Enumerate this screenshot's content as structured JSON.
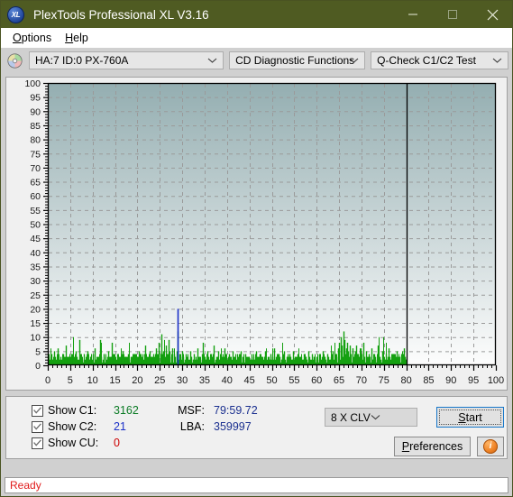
{
  "window": {
    "title": "PlexTools Professional XL V3.16",
    "app_icon_text": "XL",
    "minimize_label": "—",
    "maximize_label": "□",
    "close_label": "✕",
    "titlebar_color": "#4f5b22"
  },
  "menu": {
    "items": [
      {
        "label": "Options",
        "accel": "O"
      },
      {
        "label": "Help",
        "accel": "H"
      }
    ]
  },
  "toolbar": {
    "drive_select": {
      "value": "HA:7 ID:0  PX-760A"
    },
    "function_select": {
      "value": "CD Diagnostic Functions"
    },
    "test_select": {
      "value": "Q-Check C1/C2 Test"
    }
  },
  "controls": {
    "checkboxes": [
      {
        "label": "Show C1:",
        "value": "3162",
        "color": "#0a7a24",
        "checked": true
      },
      {
        "label": "Show C2:",
        "value": "21",
        "color": "#1a2fc8",
        "checked": true
      },
      {
        "label": "Show CU:",
        "value": "0",
        "color": "#cc0000",
        "checked": true
      }
    ],
    "readouts": [
      {
        "key": "MSF:",
        "value": "79:59.72"
      },
      {
        "key": "LBA:",
        "value": "359997"
      }
    ],
    "speed_select": {
      "value": "8 X CLV"
    },
    "start_button": {
      "label": "Start",
      "accel": "S"
    },
    "preferences_button": {
      "label": "Preferences",
      "accel": "P"
    },
    "info_button": {
      "label": "i"
    }
  },
  "status": {
    "text": "Ready",
    "color": "#e01b1b"
  },
  "chart_data": {
    "type": "bar",
    "title": "",
    "xlabel": "",
    "ylabel": "",
    "xlim": [
      0,
      100
    ],
    "ylim": [
      0,
      100
    ],
    "xticks": [
      0,
      5,
      10,
      15,
      20,
      25,
      30,
      35,
      40,
      45,
      50,
      55,
      60,
      65,
      70,
      75,
      80,
      85,
      90,
      95,
      100
    ],
    "yticks": [
      0,
      5,
      10,
      15,
      20,
      25,
      30,
      35,
      40,
      45,
      50,
      55,
      60,
      65,
      70,
      75,
      80,
      85,
      90,
      95,
      100
    ],
    "grid": true,
    "legend_position": "none",
    "data_end_marker_x": 80,
    "plot_bg_gradient": [
      "#94aeb1",
      "#fdfdfd"
    ],
    "series": [
      {
        "name": "C1",
        "color": "#14a010",
        "total": 3162,
        "baseline": 1,
        "points": [
          [
            0.2,
            3
          ],
          [
            0.5,
            2
          ],
          [
            0.8,
            4
          ],
          [
            1.1,
            2
          ],
          [
            1.4,
            5
          ],
          [
            1.7,
            2
          ],
          [
            2.0,
            3
          ],
          [
            2.3,
            6
          ],
          [
            2.6,
            2
          ],
          [
            2.9,
            3
          ],
          [
            3.2,
            2
          ],
          [
            3.5,
            4
          ],
          [
            3.8,
            3
          ],
          [
            4.1,
            7
          ],
          [
            4.4,
            2
          ],
          [
            4.7,
            3
          ],
          [
            5.0,
            2
          ],
          [
            5.3,
            4
          ],
          [
            5.6,
            3
          ],
          [
            5.9,
            2
          ],
          [
            6.2,
            5
          ],
          [
            6.5,
            3
          ],
          [
            6.8,
            2
          ],
          [
            7.1,
            9
          ],
          [
            7.4,
            3
          ],
          [
            7.7,
            2
          ],
          [
            8.0,
            4
          ],
          [
            8.3,
            2
          ],
          [
            8.6,
            3
          ],
          [
            8.9,
            5
          ],
          [
            9.2,
            2
          ],
          [
            9.5,
            3
          ],
          [
            9.8,
            2
          ],
          [
            10.1,
            4
          ],
          [
            10.4,
            6
          ],
          [
            10.7,
            2
          ],
          [
            11.0,
            3
          ],
          [
            11.3,
            2
          ],
          [
            11.6,
            9
          ],
          [
            11.9,
            3
          ],
          [
            12.2,
            2
          ],
          [
            12.5,
            4
          ],
          [
            12.8,
            3
          ],
          [
            13.1,
            2
          ],
          [
            13.4,
            5
          ],
          [
            13.7,
            2
          ],
          [
            14.0,
            3
          ],
          [
            14.3,
            8
          ],
          [
            14.6,
            2
          ],
          [
            14.9,
            3
          ],
          [
            15.2,
            2
          ],
          [
            15.5,
            4
          ],
          [
            15.8,
            3
          ],
          [
            16.1,
            2
          ],
          [
            16.4,
            3
          ],
          [
            16.7,
            5
          ],
          [
            17.0,
            2
          ],
          [
            17.3,
            3
          ],
          [
            17.6,
            2
          ],
          [
            17.9,
            4
          ],
          [
            18.2,
            3
          ],
          [
            18.5,
            2
          ],
          [
            18.8,
            3
          ],
          [
            19.1,
            2
          ],
          [
            19.4,
            4
          ],
          [
            19.7,
            2
          ],
          [
            20.0,
            3
          ],
          [
            20.3,
            5
          ],
          [
            20.6,
            2
          ],
          [
            20.9,
            3
          ],
          [
            21.2,
            2
          ],
          [
            21.5,
            4
          ],
          [
            21.8,
            7
          ],
          [
            22.1,
            3
          ],
          [
            22.4,
            2
          ],
          [
            22.7,
            5
          ],
          [
            23.0,
            3
          ],
          [
            23.3,
            2
          ],
          [
            23.6,
            4
          ],
          [
            23.9,
            3
          ],
          [
            24.2,
            6
          ],
          [
            24.5,
            3
          ],
          [
            24.8,
            8
          ],
          [
            25.1,
            4
          ],
          [
            25.4,
            11
          ],
          [
            25.7,
            5
          ],
          [
            26.0,
            3
          ],
          [
            26.3,
            7
          ],
          [
            26.6,
            4
          ],
          [
            26.9,
            9
          ],
          [
            27.2,
            5
          ],
          [
            27.5,
            3
          ],
          [
            27.8,
            6
          ],
          [
            28.1,
            4
          ],
          [
            28.4,
            3
          ],
          [
            28.7,
            5
          ],
          [
            29.0,
            12
          ],
          [
            29.3,
            4
          ],
          [
            29.6,
            3
          ],
          [
            29.9,
            5
          ],
          [
            30.2,
            3
          ],
          [
            30.5,
            2
          ],
          [
            30.8,
            4
          ],
          [
            31.1,
            3
          ],
          [
            31.4,
            2
          ],
          [
            31.7,
            5
          ],
          [
            32.0,
            3
          ],
          [
            32.3,
            2
          ],
          [
            32.6,
            4
          ],
          [
            32.9,
            3
          ],
          [
            33.2,
            2
          ],
          [
            33.5,
            6
          ],
          [
            33.8,
            3
          ],
          [
            34.1,
            2
          ],
          [
            34.4,
            4
          ],
          [
            34.7,
            8
          ],
          [
            35.0,
            3
          ],
          [
            35.3,
            2
          ],
          [
            35.6,
            5
          ],
          [
            35.9,
            3
          ],
          [
            36.2,
            2
          ],
          [
            36.5,
            4
          ],
          [
            36.8,
            3
          ],
          [
            37.1,
            7
          ],
          [
            37.4,
            2
          ],
          [
            37.7,
            3
          ],
          [
            38.0,
            5
          ],
          [
            38.3,
            2
          ],
          [
            38.6,
            4
          ],
          [
            38.9,
            3
          ],
          [
            39.2,
            2
          ],
          [
            39.5,
            6
          ],
          [
            39.8,
            3
          ],
          [
            40.1,
            2
          ],
          [
            40.4,
            4
          ],
          [
            40.7,
            3
          ],
          [
            41.0,
            2
          ],
          [
            41.3,
            5
          ],
          [
            41.6,
            3
          ],
          [
            41.9,
            2
          ],
          [
            42.2,
            4
          ],
          [
            42.5,
            3
          ],
          [
            42.8,
            2
          ],
          [
            43.1,
            5
          ],
          [
            43.4,
            3
          ],
          [
            43.7,
            2
          ],
          [
            44.0,
            4
          ],
          [
            44.3,
            3
          ],
          [
            44.6,
            2
          ],
          [
            44.9,
            3
          ],
          [
            45.2,
            2
          ],
          [
            45.5,
            4
          ],
          [
            45.8,
            3
          ],
          [
            46.1,
            2
          ],
          [
            46.4,
            5
          ],
          [
            46.7,
            3
          ],
          [
            47.0,
            2
          ],
          [
            47.3,
            4
          ],
          [
            47.6,
            3
          ],
          [
            47.9,
            2
          ],
          [
            48.2,
            3
          ],
          [
            48.5,
            5
          ],
          [
            48.8,
            2
          ],
          [
            49.1,
            3
          ],
          [
            49.4,
            2
          ],
          [
            49.7,
            4
          ],
          [
            50.0,
            3
          ],
          [
            50.3,
            2
          ],
          [
            50.6,
            6
          ],
          [
            50.9,
            3
          ],
          [
            51.2,
            2
          ],
          [
            51.5,
            4
          ],
          [
            51.8,
            3
          ],
          [
            52.1,
            2
          ],
          [
            52.4,
            3
          ],
          [
            52.7,
            5
          ],
          [
            53.0,
            2
          ],
          [
            53.3,
            3
          ],
          [
            53.6,
            2
          ],
          [
            53.9,
            4
          ],
          [
            54.2,
            3
          ],
          [
            54.5,
            2
          ],
          [
            54.8,
            5
          ],
          [
            55.1,
            3
          ],
          [
            55.4,
            2
          ],
          [
            55.7,
            4
          ],
          [
            56.0,
            3
          ],
          [
            56.3,
            2
          ],
          [
            56.6,
            3
          ],
          [
            56.9,
            2
          ],
          [
            57.2,
            4
          ],
          [
            57.5,
            3
          ],
          [
            57.8,
            2
          ],
          [
            58.1,
            5
          ],
          [
            58.4,
            3
          ],
          [
            58.7,
            2
          ],
          [
            59.0,
            4
          ],
          [
            59.3,
            3
          ],
          [
            59.6,
            2
          ],
          [
            59.9,
            3
          ],
          [
            60.2,
            2
          ],
          [
            60.5,
            4
          ],
          [
            60.8,
            3
          ],
          [
            61.1,
            2
          ],
          [
            61.4,
            5
          ],
          [
            61.7,
            3
          ],
          [
            62.0,
            2
          ],
          [
            62.3,
            4
          ],
          [
            62.6,
            3
          ],
          [
            62.9,
            2
          ],
          [
            63.2,
            3
          ],
          [
            63.5,
            5
          ],
          [
            63.8,
            2
          ],
          [
            64.1,
            4
          ],
          [
            64.4,
            3
          ],
          [
            64.7,
            6
          ],
          [
            65.0,
            8
          ],
          [
            65.3,
            10
          ],
          [
            65.6,
            7
          ],
          [
            65.9,
            12
          ],
          [
            66.2,
            9
          ],
          [
            66.5,
            6
          ],
          [
            66.8,
            8
          ],
          [
            67.1,
            5
          ],
          [
            67.4,
            7
          ],
          [
            67.7,
            4
          ],
          [
            68.0,
            6
          ],
          [
            68.3,
            3
          ],
          [
            68.6,
            5
          ],
          [
            68.9,
            7
          ],
          [
            69.2,
            4
          ],
          [
            69.5,
            3
          ],
          [
            69.8,
            6
          ],
          [
            70.1,
            4
          ],
          [
            70.4,
            8
          ],
          [
            70.7,
            3
          ],
          [
            71.0,
            5
          ],
          [
            71.3,
            2
          ],
          [
            71.6,
            4
          ],
          [
            71.9,
            3
          ],
          [
            72.2,
            6
          ],
          [
            72.5,
            2
          ],
          [
            72.8,
            4
          ],
          [
            73.1,
            3
          ],
          [
            73.4,
            2
          ],
          [
            73.7,
            7
          ],
          [
            74.0,
            3
          ],
          [
            74.3,
            2
          ],
          [
            74.6,
            5
          ],
          [
            74.9,
            3
          ],
          [
            75.2,
            2
          ],
          [
            75.5,
            4
          ],
          [
            75.8,
            3
          ],
          [
            76.1,
            6
          ],
          [
            76.4,
            2
          ],
          [
            76.7,
            3
          ],
          [
            77.0,
            4
          ],
          [
            77.3,
            2
          ],
          [
            77.6,
            3
          ],
          [
            77.9,
            5
          ],
          [
            78.2,
            2
          ],
          [
            78.5,
            3
          ],
          [
            78.8,
            4
          ],
          [
            79.1,
            2
          ],
          [
            79.4,
            6
          ],
          [
            79.7,
            3
          ],
          [
            79.9,
            2
          ]
        ]
      },
      {
        "name": "C2",
        "color": "#1a2fc8",
        "total": 21,
        "points": [
          [
            29.05,
            20
          ]
        ]
      },
      {
        "name": "CU",
        "color": "#cc0000",
        "total": 0,
        "points": []
      }
    ]
  }
}
